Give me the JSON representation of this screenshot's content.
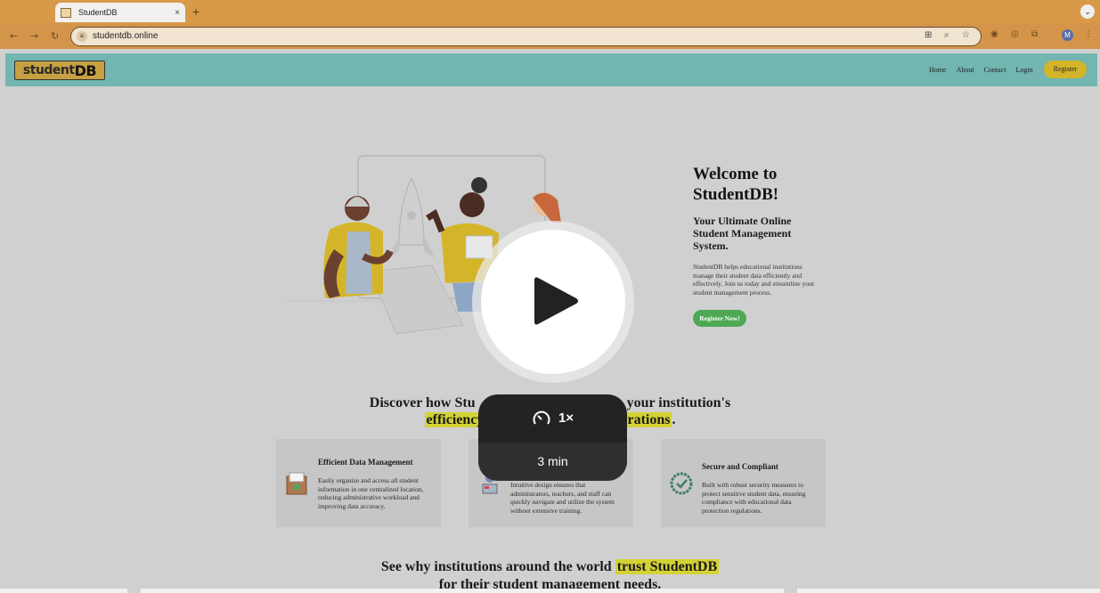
{
  "browser": {
    "tab_title": "StudentDB",
    "tab_close": "×",
    "new_tab": "+",
    "url": "studentdb.online",
    "avatar_letter": "M"
  },
  "site": {
    "logo_text_a": "student",
    "logo_text_b": "DB",
    "nav": [
      "Home",
      "About",
      "Contact",
      "Login"
    ],
    "register_button": "Register"
  },
  "hero": {
    "title": "Welcome to StudentDB!",
    "subtitle": "Your Ultimate Online Student Management System.",
    "description": "StudentDB helps educational institutions manage their student data efficiently and effectively. Join us today and streamline your student management process.",
    "cta": "Register Now!"
  },
  "discover": {
    "line1_a": "Discover how Stu",
    "line1_b": "your institution's",
    "line2_a": "efficiency",
    "line2_b": "erations",
    "line2_end": "."
  },
  "features": [
    {
      "title": "Efficient Data Management",
      "text": "Easily organize and access all student information in one centralized location, reducing administrative workload and improving data accuracy."
    },
    {
      "title": "",
      "text": "Intuitive design ensures that administrators, teachers, and staff can quickly navigate and utilize the system without extensive training."
    },
    {
      "title": "Secure and Compliant",
      "text": "Built with robust security measures to protect sensitive student data, ensuring compliance with educational data protection regulations."
    }
  ],
  "trust": {
    "line1_a": "See why institutions around the world",
    "line1_hl": "trust StudentDB",
    "line2": "for their student management needs."
  },
  "video_overlay": {
    "speed": "1×",
    "duration": "3 min"
  },
  "colors": {
    "browser_frame": "#d89a48",
    "site_nav": "#72b5b1",
    "register_button": "#d4b52a",
    "cta_green": "#4ea854",
    "highlight": "#d4d234"
  }
}
